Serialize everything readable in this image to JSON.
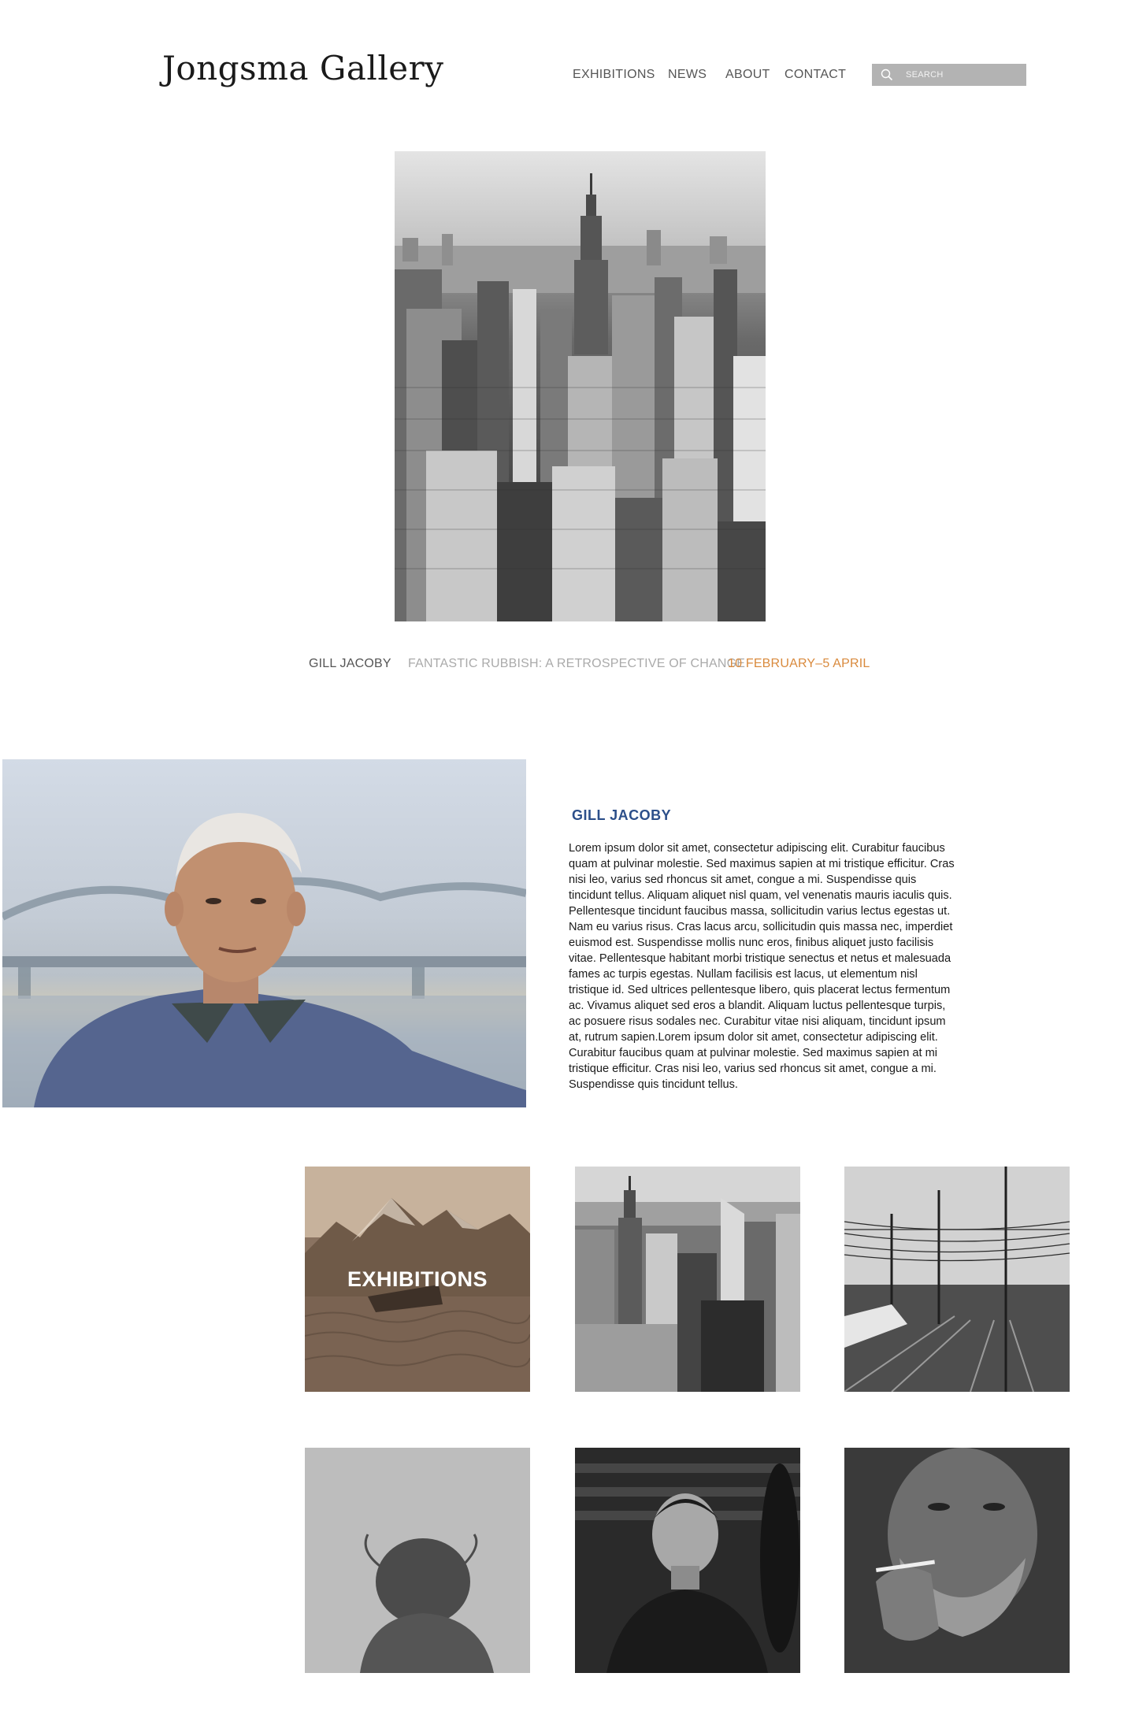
{
  "brand": {
    "name": "Jongsma Gallery"
  },
  "nav": {
    "items": [
      {
        "label": "EXHIBITIONS"
      },
      {
        "label": "NEWS"
      },
      {
        "label": "ABOUT"
      },
      {
        "label": "CONTACT"
      }
    ]
  },
  "search": {
    "placeholder": "SEARCH",
    "icon": "search-icon"
  },
  "featured": {
    "image": "city-skyline-photo",
    "artist": "GILL JACOBY",
    "title": "FANTASTIC RUBBISH: A RETROSPECTIVE OF CHANGE",
    "dates": "10 FEBRUARY–5 APRIL"
  },
  "artist_section": {
    "image": "portrait-photo",
    "heading": "GILL JACOBY",
    "bio": "Lorem ipsum dolor sit amet, consectetur adipiscing elit. Curabitur faucibus quam at pulvinar molestie. Sed maximus sapien at mi tristique efficitur. Cras nisi leo, varius sed rhoncus sit amet, congue a mi. Suspendisse quis tincidunt tellus. Aliquam aliquet nisl quam, vel venenatis mauris iaculis quis. Pellentesque tincidunt faucibus massa, sollicitudin varius lectus egestas ut. Nam eu varius risus. Cras lacus arcu, sollicitudin quis massa nec, imperdiet euismod est. Suspendisse mollis nunc eros, finibus aliquet justo facilisis vitae. Pellentesque habitant morbi tristique senectus et netus et malesuada fames ac turpis egestas. Nullam facilisis est lacus, ut elementum nisl tristique id. Sed ultrices pellentesque libero, quis placerat lectus fermentum ac. Vivamus aliquet sed eros a blandit. Aliquam luctus pellentesque turpis, ac posuere risus sodales nec. Curabitur vitae nisi aliquam, tincidunt ipsum at, rutrum sapien.Lorem ipsum dolor sit amet, consectetur adipiscing elit. Curabitur faucibus quam at pulvinar molestie. Sed maximus sapien at mi tristique efficitur. Cras nisi leo, varius sed rhoncus sit amet, congue a mi. Suspendisse quis tincidunt tellus."
  },
  "grid": {
    "tiles": [
      {
        "image": "mountain-ship-photo",
        "label": "EXHIBITIONS"
      },
      {
        "image": "city-skyline-photo",
        "label": ""
      },
      {
        "image": "railway-photo",
        "label": ""
      },
      {
        "image": "woman-head-photo",
        "label": ""
      },
      {
        "image": "young-man-portrait-photo",
        "label": ""
      },
      {
        "image": "old-man-smoking-photo",
        "label": ""
      }
    ]
  },
  "colors": {
    "accent_date": "#d98a3d",
    "heading_blue": "#2c4f8a",
    "search_bg": "#b3b3b3",
    "nav_text": "#555555"
  }
}
